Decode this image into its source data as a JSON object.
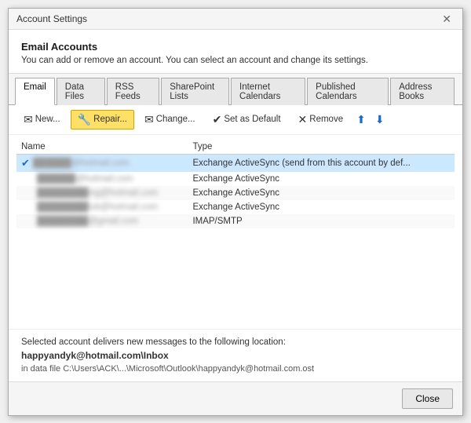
{
  "window": {
    "title": "Account Settings",
    "close_label": "✕"
  },
  "header": {
    "heading": "Email Accounts",
    "description": "You can add or remove an account. You can select an account and change its settings."
  },
  "tabs": [
    {
      "id": "email",
      "label": "Email",
      "active": true
    },
    {
      "id": "data-files",
      "label": "Data Files",
      "active": false
    },
    {
      "id": "rss-feeds",
      "label": "RSS Feeds",
      "active": false
    },
    {
      "id": "sharepoint",
      "label": "SharePoint Lists",
      "active": false
    },
    {
      "id": "internet-cals",
      "label": "Internet Calendars",
      "active": false
    },
    {
      "id": "published-cals",
      "label": "Published Calendars",
      "active": false
    },
    {
      "id": "address-books",
      "label": "Address Books",
      "active": false
    }
  ],
  "toolbar": {
    "new_label": "New...",
    "repair_label": "Repair...",
    "change_label": "Change...",
    "set_default_label": "Set as Default",
    "remove_label": "Remove"
  },
  "table": {
    "col_name": "Name",
    "col_type": "Type",
    "rows": [
      {
        "name": "██████@hotmail.com",
        "type": "Exchange ActiveSync (send from this account by def...",
        "selected": true,
        "default": true
      },
      {
        "name": "██████@hotmail.com",
        "type": "Exchange ActiveSync",
        "selected": false,
        "default": false
      },
      {
        "name": "████████ing@hotmail.com",
        "type": "Exchange ActiveSync",
        "selected": false,
        "default": false
      },
      {
        "name": "████████lub@hotmail.com",
        "type": "Exchange ActiveSync",
        "selected": false,
        "default": false
      },
      {
        "name": "████████@gmail.com",
        "type": "IMAP/SMTP",
        "selected": false,
        "default": false
      }
    ]
  },
  "footer": {
    "description": "Selected account delivers new messages to the following location:",
    "inbox_path": "happyandyk@hotmail.com\\Inbox",
    "data_path": "in data file C:\\Users\\ACK\\...\\Microsoft\\Outlook\\happyandyk@hotmail.com.ost"
  },
  "bottom": {
    "close_label": "Close"
  }
}
